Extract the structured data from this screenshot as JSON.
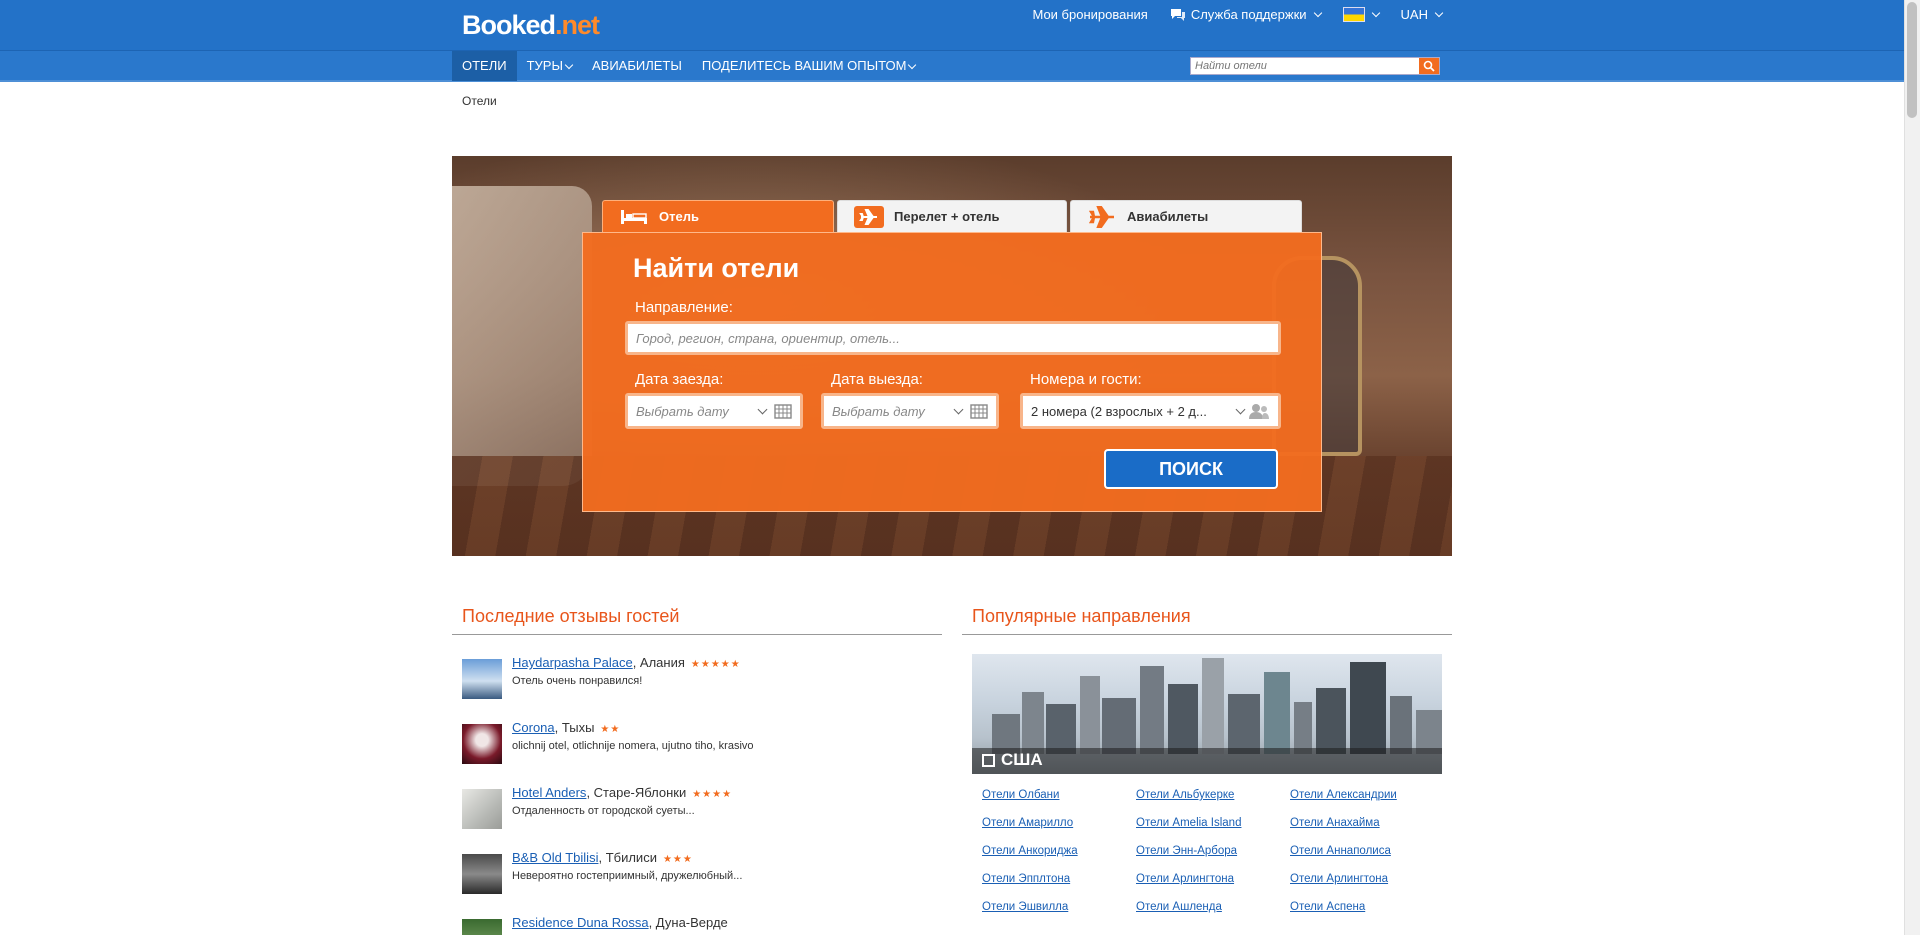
{
  "header": {
    "logo_main": "Booked",
    "logo_tld": ".net",
    "my_bookings": "Мои бронирования",
    "support": "Служба поддержки",
    "currency": "UAH"
  },
  "nav": {
    "items": [
      {
        "label": "ОТЕЛИ",
        "active": true
      },
      {
        "label": "ТУРЫ",
        "dropdown": true
      },
      {
        "label": "АВИАБИЛЕТЫ"
      },
      {
        "label": "ПОДЕЛИТЕСЬ ВАШИМ ОПЫТОМ",
        "dropdown": true
      }
    ],
    "search_placeholder": "Найти отели"
  },
  "breadcrumb": "Отели",
  "search": {
    "tabs": [
      {
        "label": "Отель",
        "icon": "bed-icon",
        "active": true
      },
      {
        "label": "Перелет + отель",
        "icon": "plane-box-icon"
      },
      {
        "label": "Авиабилеты",
        "icon": "plane-icon"
      }
    ],
    "title": "Найти отели",
    "destination_label": "Направление:",
    "destination_placeholder": "Город, регион, страна, ориентир, отель...",
    "checkin_label": "Дата заезда:",
    "checkin_placeholder": "Выбрать дату",
    "checkout_label": "Дата выезда:",
    "checkout_placeholder": "Выбрать дату",
    "rooms_label": "Номера и гости:",
    "rooms_value": "2 номера (2 взрослых + 2 д...",
    "submit": "ПОИСК",
    "accent": "#f26c1f",
    "button_color": "#1a6cc7"
  },
  "reviews": {
    "title": "Последние отзывы гостей",
    "items": [
      {
        "hotel": "Haydarpasha Palace",
        "city": ", Алания",
        "stars": "★★★★★",
        "text": "Отель очень понравился!"
      },
      {
        "hotel": "Corona",
        "city": ", Тыхы",
        "stars": "★★",
        "text": "olichnij otel, otlichnije nomera, ujutno tiho, krasivo"
      },
      {
        "hotel": "Hotel Anders",
        "city": ", Старе-Яблонки",
        "stars": "★★★★",
        "text": "Отдаленность от городской суеты..."
      },
      {
        "hotel": "B&B Old Tbilisi",
        "city": ", Тбилиси",
        "stars": "★★★",
        "text": "Невероятно гостеприимный, дружелюбный..."
      },
      {
        "hotel": "Residence Duna Rossa",
        "city": ", Дуна-Верде",
        "stars": "",
        "text": ""
      }
    ]
  },
  "popular": {
    "title": "Популярные направления",
    "country": "США",
    "links": [
      "Отели Олбани",
      "Отели Альбукерке",
      "Отели Александрии",
      "Отели Амарилло",
      "Отели Amelia Island",
      "Отели Анахайма",
      "Отели Анкориджа",
      "Отели Энн-Арбора",
      "Отели Аннаполиса",
      "Отели Эпплтона",
      "Отели Арлингтона",
      "Отели Арлингтона",
      "Отели Эшвилла",
      "Отели Ашленда",
      "Отели Аспена"
    ]
  }
}
